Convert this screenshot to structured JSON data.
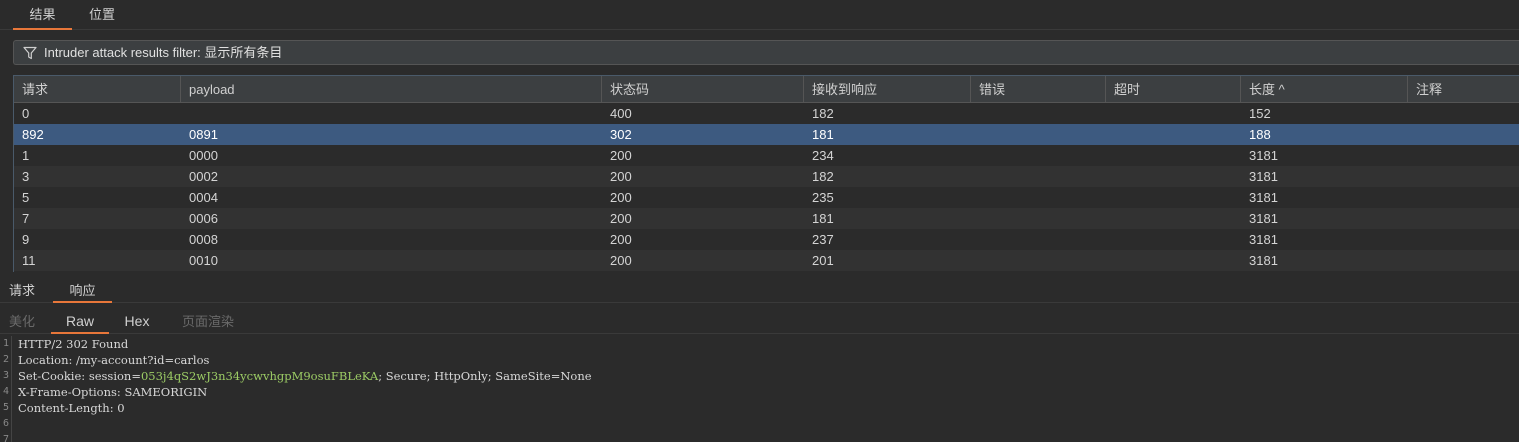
{
  "top_tabs": [
    {
      "label": "结果",
      "active": true
    },
    {
      "label": "位置",
      "active": false
    }
  ],
  "filter": {
    "icon": "filter-icon",
    "text": "Intruder attack results filter: 显示所有条目"
  },
  "table": {
    "headers": [
      "请求",
      "payload",
      "状态码",
      "接收到响应",
      "错误",
      "超时",
      "长度 ^",
      "注释"
    ],
    "sort_column": "长度",
    "rows": [
      {
        "request": "0",
        "payload": "",
        "status": "400",
        "received": "182",
        "error": "",
        "timeout": "",
        "length": "152",
        "comment": "",
        "selected": false
      },
      {
        "request": "892",
        "payload": "0891",
        "status": "302",
        "received": "181",
        "error": "",
        "timeout": "",
        "length": "188",
        "comment": "",
        "selected": true
      },
      {
        "request": "1",
        "payload": "0000",
        "status": "200",
        "received": "234",
        "error": "",
        "timeout": "",
        "length": "3181",
        "comment": "",
        "selected": false
      },
      {
        "request": "3",
        "payload": "0002",
        "status": "200",
        "received": "182",
        "error": "",
        "timeout": "",
        "length": "3181",
        "comment": "",
        "selected": false
      },
      {
        "request": "5",
        "payload": "0004",
        "status": "200",
        "received": "235",
        "error": "",
        "timeout": "",
        "length": "3181",
        "comment": "",
        "selected": false
      },
      {
        "request": "7",
        "payload": "0006",
        "status": "200",
        "received": "181",
        "error": "",
        "timeout": "",
        "length": "3181",
        "comment": "",
        "selected": false
      },
      {
        "request": "9",
        "payload": "0008",
        "status": "200",
        "received": "237",
        "error": "",
        "timeout": "",
        "length": "3181",
        "comment": "",
        "selected": false
      },
      {
        "request": "11",
        "payload": "0010",
        "status": "200",
        "received": "201",
        "error": "",
        "timeout": "",
        "length": "3181",
        "comment": "",
        "selected": false
      }
    ]
  },
  "lower_tabs": [
    {
      "label": "请求",
      "active": false
    },
    {
      "label": "响应",
      "active": true
    }
  ],
  "view_tabs": [
    {
      "label": "美化",
      "active": false,
      "disabled": true
    },
    {
      "label": "Raw",
      "active": true,
      "disabled": false
    },
    {
      "label": "Hex",
      "active": false,
      "disabled": false
    },
    {
      "label": "页面渲染",
      "active": false,
      "disabled": true
    }
  ],
  "response": {
    "line_numbers": [
      "1",
      "2",
      "3",
      "4",
      "5",
      "6",
      "7"
    ],
    "line1": "HTTP/2 302 Found",
    "line2": "Location: /my-account?id=carlos",
    "line3_prefix": "Set-Cookie: session=",
    "line3_value": "053j4qS2wJ3n34ycwvhgpM9osuFBLeKA",
    "line3_suffix": "; Secure; HttpOnly; SameSite=None",
    "line4": "X-Frame-Options: SAMEORIGIN",
    "line5": "Content-Length: 0",
    "line6": "",
    "line7": ""
  },
  "colors": {
    "accent": "#e8773a",
    "selection": "#3d5a80",
    "cookie_value": "#9ccc65",
    "background": "#2b2b2b"
  }
}
